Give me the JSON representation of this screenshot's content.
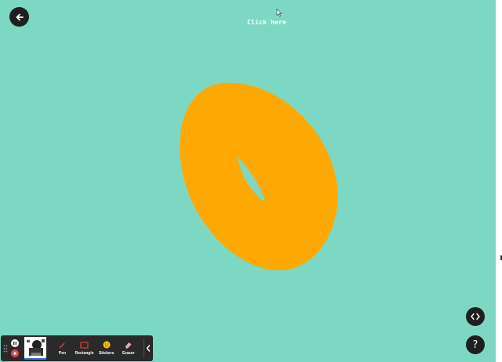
{
  "stage": {
    "background_color": "#7dd8c3",
    "click_here_label": "Click here"
  },
  "shape": {
    "name": "torus",
    "color": "#ffa801"
  },
  "navigation": {
    "back_icon": "arrow-left-icon",
    "code_icon": "code-brackets-icon",
    "help_label": "?"
  },
  "toolbar": {
    "recording": {
      "pause_icon": "pause-icon",
      "stop_icon": "stop-icon"
    },
    "tools": [
      {
        "id": "pen",
        "label": "Pen",
        "icon": "pen-icon",
        "color": "#e53935"
      },
      {
        "id": "rectangle",
        "label": "Rectangle",
        "icon": "rectangle-icon",
        "color": "#e53935"
      },
      {
        "id": "stickers",
        "label": "Stickers",
        "icon": "smiley-icon",
        "color": "#f5c518"
      },
      {
        "id": "eraser",
        "label": "Eraser",
        "icon": "eraser-icon",
        "color": "#f2a0b0"
      }
    ],
    "collapse_icon": "chevron-left-icon"
  }
}
